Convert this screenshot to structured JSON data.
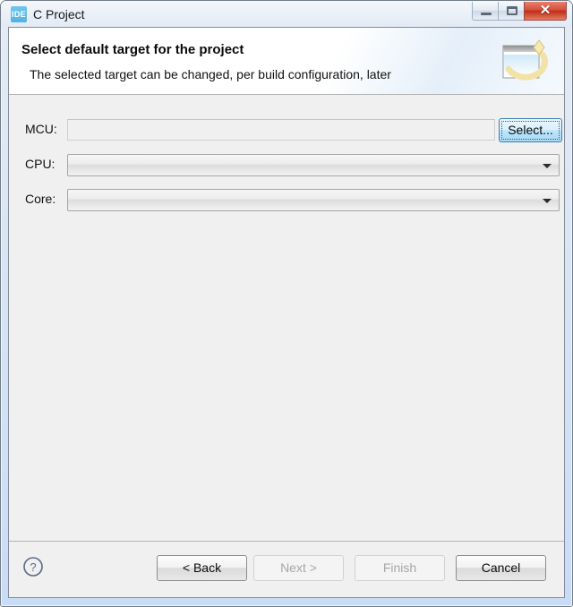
{
  "window": {
    "title": "C Project",
    "app_icon_label": "IDE",
    "buttons": {
      "minimize": "minimize-button",
      "maximize": "maximize-button",
      "close": "✕"
    }
  },
  "wizard": {
    "heading": "Select default target for the project",
    "subheading": "The selected target can be changed, per build configuration, later",
    "banner_icon": "wizard-window-sparkle-icon"
  },
  "form": {
    "fields": [
      {
        "label": "MCU:",
        "value": "",
        "placeholder": "",
        "type": "text"
      },
      {
        "label": "CPU:",
        "value": "",
        "placeholder": "",
        "type": "combo"
      },
      {
        "label": "Core:",
        "value": "",
        "placeholder": "",
        "type": "combo"
      }
    ],
    "select_button": "Select..."
  },
  "footer": {
    "help_icon": "help-question-icon",
    "back": "< Back",
    "next": "Next >",
    "finish": "Finish",
    "cancel": "Cancel"
  },
  "colors": {
    "accent": "#3c7fb1",
    "focus_fill": "#bee6fd",
    "close_red": "#bf2d16",
    "dialog_bg": "#f0f0f0",
    "header_bg": "#ffffff"
  }
}
